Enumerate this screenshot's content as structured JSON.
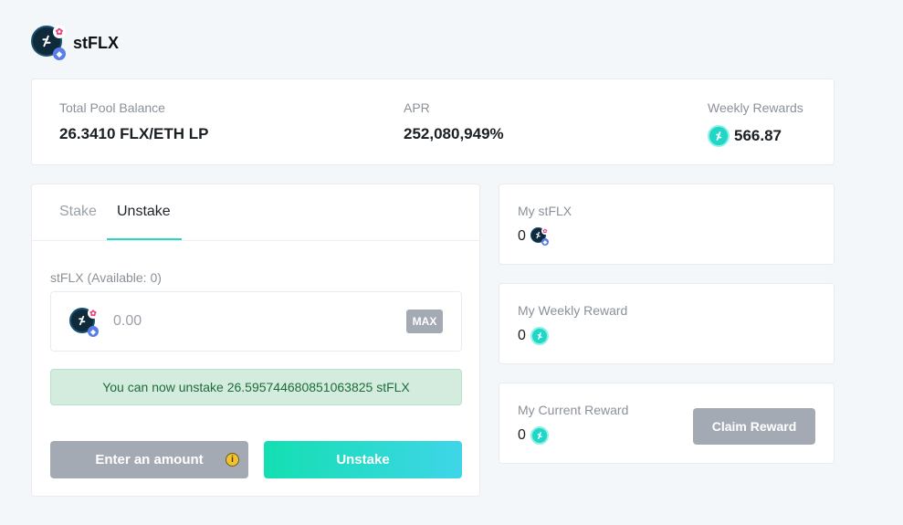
{
  "header": {
    "title": "stFLX"
  },
  "stats": {
    "pool_label": "Total Pool Balance",
    "pool_value": "26.3410 FLX/ETH LP",
    "apr_label": "APR",
    "apr_value": "252,080,949%",
    "weekly_label": "Weekly Rewards",
    "weekly_value": "566.87"
  },
  "tabs": {
    "stake": "Stake",
    "unstake": "Unstake",
    "active": "Unstake"
  },
  "form": {
    "available_label": "stFLX (Available: 0)",
    "amount_placeholder": "0.00",
    "max_label": "MAX",
    "notice": "You can now unstake 26.595744680851063825 stFLX",
    "enter_amount_label": "Enter an amount",
    "info_glyph": "i",
    "unstake_label": "Unstake"
  },
  "cards": {
    "my_stflx": {
      "label": "My stFLX",
      "value": "0"
    },
    "weekly_reward": {
      "label": "My Weekly Reward",
      "value": "0"
    },
    "current_reward": {
      "label": "My Current Reward",
      "value": "0",
      "claim_label": "Claim Reward"
    }
  },
  "icons": {
    "lp_token": "flx-eth-lp-token-icon",
    "flx_token": "flx-token-icon",
    "info": "info-icon"
  },
  "colors": {
    "accent": "#2bd6c0",
    "unstake_gradient_start": "#14dfb1",
    "unstake_gradient_end": "#3fd5e8",
    "disabled_button": "#a3aab3",
    "notice_bg": "#d3ecdd",
    "notice_text": "#1e6b3c"
  }
}
